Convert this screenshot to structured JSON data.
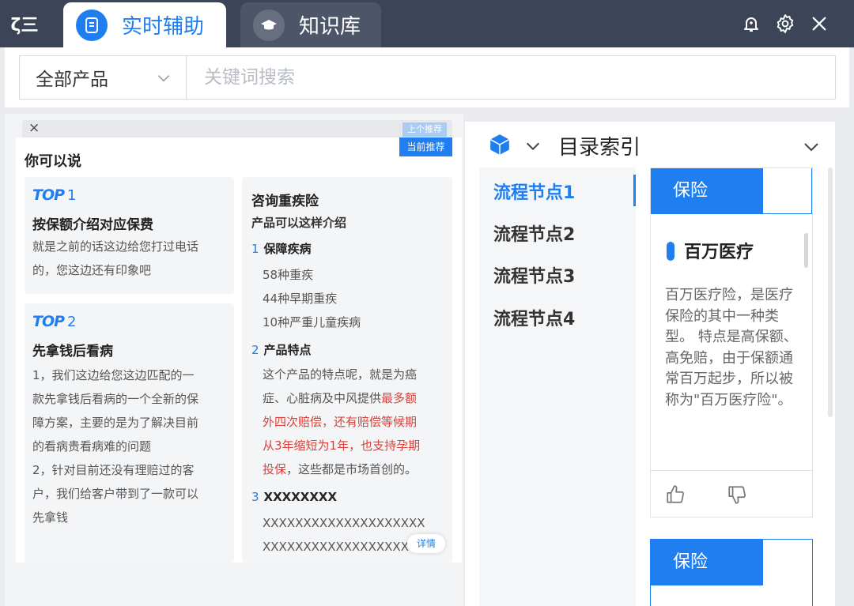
{
  "titlebar": {
    "logo": "ζ三",
    "tabs": [
      {
        "label": "实时辅助",
        "active": true
      },
      {
        "label": "知识库",
        "active": false
      }
    ]
  },
  "search": {
    "product_selected": "全部产品",
    "placeholder": "关键词搜索"
  },
  "suggest": {
    "dismiss": "×",
    "prev_label": "上个推荐",
    "current_label": "当前推荐",
    "title": "你可以说",
    "cards": [
      {
        "badge": "TOP",
        "rank": "1",
        "title": "按保额介绍对应保费",
        "lines": [
          "就是之前的话这边给您打过电话",
          "的，您这边还有印象吧"
        ]
      },
      {
        "badge": "TOP",
        "rank": "2",
        "title": "先拿钱后看病",
        "lines": [
          "1，我们这边给您这边匹配的一",
          "款先拿钱后看病的一个全新的保",
          "障方案，主要的是为了解决目前",
          "的看病贵看病难的问题",
          "2，针对目前还没有理赔过的客",
          "户，我们给客户带到了一款可以",
          "先拿钱"
        ]
      }
    ],
    "detail_card": {
      "title": "咨询重疾险",
      "subtitle": "产品可以这样介绍",
      "sections": [
        {
          "index": "1",
          "heading": "保障疾病",
          "items": [
            "58种重疾",
            "44种早期重疾",
            "10种严重儿童疾病"
          ]
        },
        {
          "index": "2",
          "heading": "产品特点",
          "lines": [
            {
              "plain": "这个产品的特点呢，就是为癌",
              "hl": ""
            },
            {
              "plain": "症、心脏病及中风提供",
              "hl": "最多额"
            },
            {
              "plain": "",
              "hl": "外四次赔偿，还有赔偿等候期"
            },
            {
              "plain": "",
              "hl": "从3年缩短为1年，也支持孕期"
            },
            {
              "plain": "，这些都是市场首创的。",
              "hl": "投保",
              "hl_first": true
            }
          ]
        },
        {
          "index": "3",
          "heading": "XXXXXXXX",
          "items": [
            "XXXXXXXXXXXXXXXXXXXX",
            "XXXXXXXXXXXXXXXXXX"
          ]
        }
      ],
      "detail_button": "详情"
    }
  },
  "catalog": {
    "title": "目录索引",
    "nodes": [
      "流程节点1",
      "流程节点2",
      "流程节点3",
      "流程节点4"
    ],
    "active_node": 0,
    "cards": [
      {
        "tag": "保险",
        "title": "百万医疗",
        "body": "百万医疗险，是医疗保险的其中一种类型。 特点是高保额、高免赔，由于保额通常百万起步，所以被称为\"百万医疗险\"。"
      },
      {
        "tag": "保险"
      }
    ]
  },
  "colors": {
    "accent": "#1f7ef0",
    "titlebar": "#3c4457",
    "highlight": "#d9423a"
  }
}
